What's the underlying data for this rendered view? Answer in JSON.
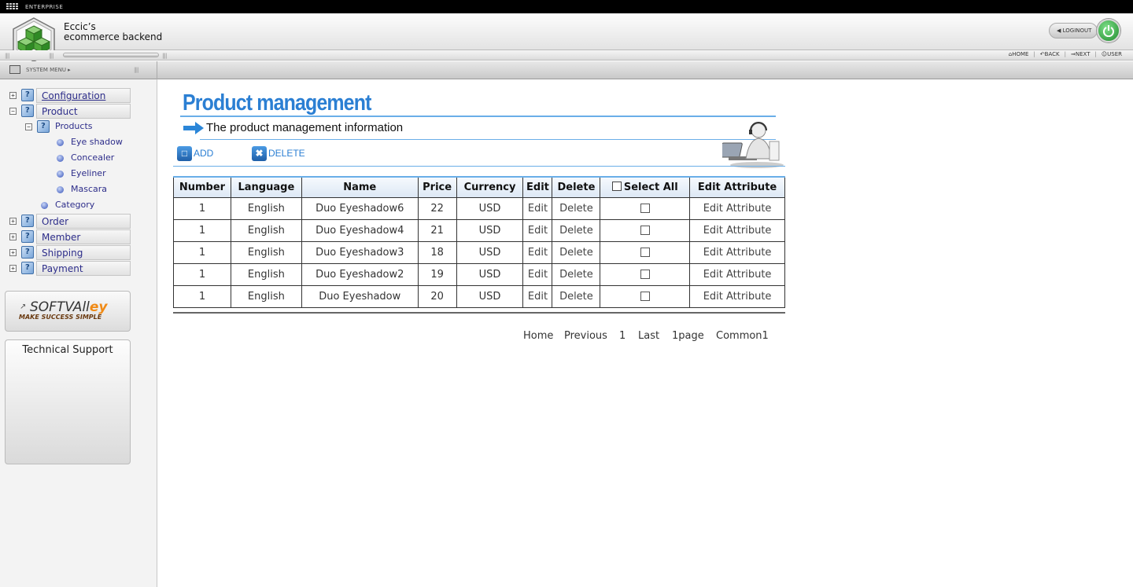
{
  "topbar": {
    "label": "ENTERPRISE"
  },
  "header": {
    "brand_line1": "Eccic’s",
    "brand_line2": "ecommerce backend",
    "logout_label": "LOGINOUT"
  },
  "topnav": {
    "home": "HOME",
    "back": "BACK",
    "next": "NEXT",
    "user": "USER"
  },
  "sysbar": {
    "label": "SYSTEM MENU ▸"
  },
  "sidebar": {
    "items": [
      {
        "label": "Configuration",
        "toggle": "+"
      },
      {
        "label": "Product",
        "toggle": "−"
      },
      {
        "label": "Order",
        "toggle": "+"
      },
      {
        "label": "Member",
        "toggle": "+"
      },
      {
        "label": "Shipping",
        "toggle": "+"
      },
      {
        "label": "Payment",
        "toggle": "+"
      }
    ],
    "products_label": "Products",
    "products_toggle": "−",
    "product_children": [
      "Eye shadow",
      "Concealer",
      "Eyeliner",
      "Mascara"
    ],
    "category_label": "Category",
    "softvalley": {
      "name_main": "SOFTVAll",
      "name_accent": "ey",
      "tagline": "MAKE SUCCESS SIMPLE"
    },
    "support_title": "Technical Support"
  },
  "main": {
    "title": "Product management",
    "subtitle": "The product management information",
    "add_label": "ADD",
    "delete_label": "DELETE",
    "table": {
      "headers": [
        "Number",
        "Language",
        "Name",
        "Price",
        "Currency",
        "Edit",
        "Delete",
        "Select All",
        "Edit Attribute"
      ],
      "rows": [
        {
          "number": "1",
          "language": "English",
          "name": "Duo Eyeshadow6",
          "price": "22",
          "currency": "USD",
          "edit": "Edit",
          "delete": "Delete",
          "attr": "Edit Attribute"
        },
        {
          "number": "1",
          "language": "English",
          "name": "Duo Eyeshadow4",
          "price": "21",
          "currency": "USD",
          "edit": "Edit",
          "delete": "Delete",
          "attr": "Edit Attribute"
        },
        {
          "number": "1",
          "language": "English",
          "name": "Duo Eyeshadow3",
          "price": "18",
          "currency": "USD",
          "edit": "Edit",
          "delete": "Delete",
          "attr": "Edit Attribute"
        },
        {
          "number": "1",
          "language": "English",
          "name": "Duo Eyeshadow2",
          "price": "19",
          "currency": "USD",
          "edit": "Edit",
          "delete": "Delete",
          "attr": "Edit Attribute"
        },
        {
          "number": "1",
          "language": "English",
          "name": "Duo Eyeshadow",
          "price": "20",
          "currency": "USD",
          "edit": "Edit",
          "delete": "Delete",
          "attr": "Edit Attribute"
        }
      ]
    },
    "pager": {
      "home": "Home",
      "previous": "Previous",
      "page": "1",
      "last": "Last",
      "pages": "1page",
      "common": "Common1"
    }
  },
  "colors": {
    "accent": "#2b7fd3",
    "link": "#2d2d8a"
  }
}
